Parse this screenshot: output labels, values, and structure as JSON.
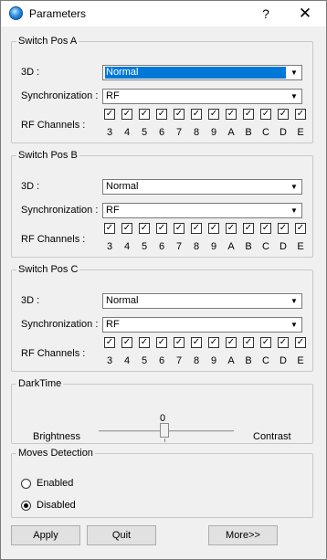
{
  "window": {
    "title": "Parameters",
    "help_label": "?",
    "close_label": "✕"
  },
  "groups": [
    {
      "title": "Switch Pos A",
      "mode_label": "3D :",
      "mode_value": "Normal",
      "sync_label": "Synchronization :",
      "sync_value": "RF",
      "channels_label": "RF Channels :",
      "channels": [
        "3",
        "4",
        "5",
        "6",
        "7",
        "8",
        "9",
        "A",
        "B",
        "C",
        "D",
        "E"
      ]
    },
    {
      "title": "Switch Pos B",
      "mode_label": "3D :",
      "mode_value": "Normal",
      "sync_label": "Synchronization :",
      "sync_value": "RF",
      "channels_label": "RF Channels :",
      "channels": [
        "3",
        "4",
        "5",
        "6",
        "7",
        "8",
        "9",
        "A",
        "B",
        "C",
        "D",
        "E"
      ]
    },
    {
      "title": "Switch Pos C",
      "mode_label": "3D :",
      "mode_value": "Normal",
      "sync_label": "Synchronization :",
      "sync_value": "RF",
      "channels_label": "RF Channels :",
      "channels": [
        "3",
        "4",
        "5",
        "6",
        "7",
        "8",
        "9",
        "A",
        "B",
        "C",
        "D",
        "E"
      ]
    }
  ],
  "darktime": {
    "title": "DarkTime",
    "value": "0",
    "left_label": "Brightness",
    "right_label": "Contrast"
  },
  "moves": {
    "title": "Moves Detection",
    "enabled_label": "Enabled",
    "disabled_label": "Disabled",
    "selected": "Disabled"
  },
  "buttons": {
    "apply": "Apply",
    "quit": "Quit",
    "more": "More>>"
  }
}
